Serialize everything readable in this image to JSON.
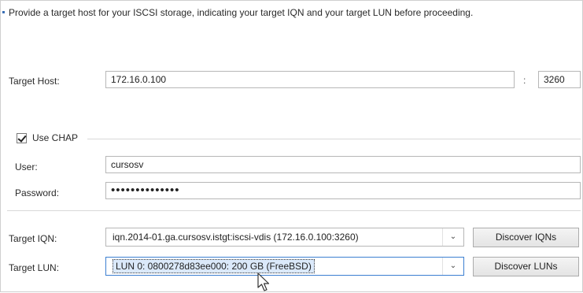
{
  "description": "Provide a target host for your ISCSI storage, indicating your target IQN and your target LUN before proceeding.",
  "target_host": {
    "label": "Target Host:",
    "value": "172.16.0.100",
    "separator": ":",
    "port": "3260"
  },
  "chap": {
    "label": "Use CHAP",
    "checked": true,
    "user_label": "User:",
    "user_value": "cursosv",
    "password_label": "Password:",
    "password_value": "••••••••••••••"
  },
  "iqn": {
    "label": "Target IQN:",
    "selected": "iqn.2014-01.ga.cursosv.istgt:iscsi-vdis (172.16.0.100:3260)",
    "button": "Discover IQNs"
  },
  "lun": {
    "label": "Target LUN:",
    "selected": "LUN 0: 0800278d83ee000: 200 GB (FreeBSD)",
    "button": "Discover LUNs"
  },
  "icons": {
    "checkbox": "checkmark-icon",
    "dropdown": "chevron-down-icon",
    "cursor": "mouse-pointer-icon"
  },
  "colors": {
    "focus_border": "#3c7fd1",
    "selection_bg": "#dbe9fa"
  }
}
